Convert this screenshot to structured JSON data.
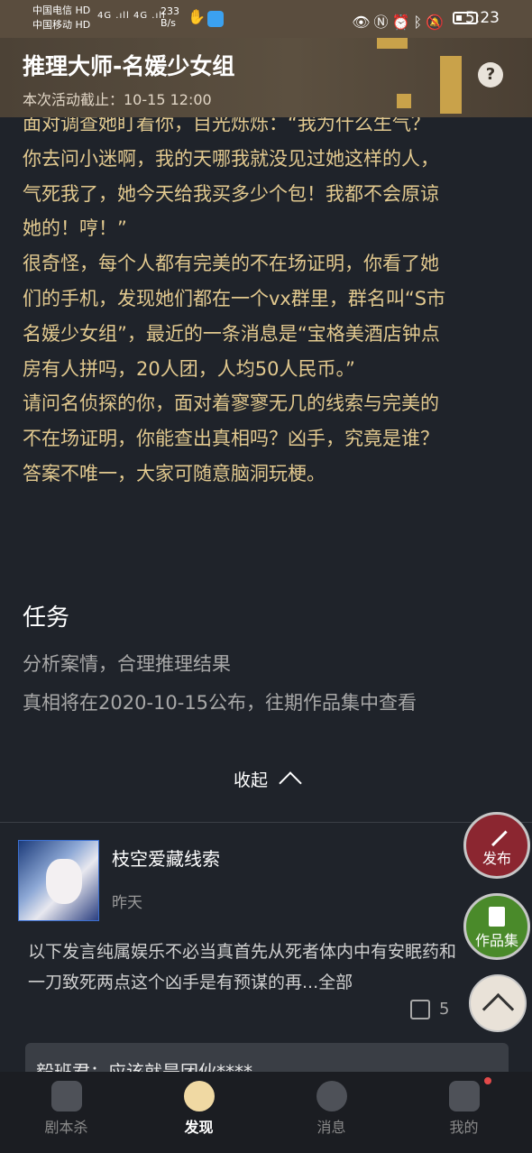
{
  "status_bar": {
    "carrier_1": "中国电信 HD",
    "carrier_2": "中国移动 HD",
    "signal": "4G .ıll 4G .ıll",
    "net_speed_value": "233",
    "net_speed_unit": "B/s",
    "icons": [
      "eye-icon",
      "nfc-icon",
      "alarm-icon",
      "bluetooth-icon",
      "mute-icon",
      "battery-icon"
    ],
    "time": "5:23"
  },
  "header": {
    "title": "推理大师-名媛少女组",
    "deadline": "本次活动截止：10-15 12:00",
    "help_glyph": "?"
  },
  "story": {
    "lines": [
      "面对调查她盯着你，目光烁烁：“我为什么生气？",
      "你去问小迷啊，我的天哪我就没见过她这样的人，",
      "气死我了，她今天给我买多少个包！我都不会原谅",
      "她的！哼！”",
      "很奇怪，每个人都有完美的不在场证明，你看了她",
      "们的手机，发现她们都在一个vx群里，群名叫“S市",
      "名媛少女组”，最近的一条消息是“宝格美酒店钟点",
      "房有人拼吗，20人团，人均50人民币。”",
      "请问名侦探的你，面对着寥寥无几的线索与完美的",
      "不在场证明，你能查出真相吗？凶手，究竟是谁？",
      "答案不唯一，大家可随意脑洞玩梗。"
    ]
  },
  "task": {
    "title": "任务",
    "line1": "分析案情，合理推理结果",
    "line2": "真相将在2020-10-15公布，往期作品集中查看"
  },
  "collapse_label": "收起",
  "post": {
    "username": "枝空爱藏线索",
    "time": "昨天",
    "text": "以下发言纯属娱乐不必当真首先从死者体内中有安眠药和一刀致死两点这个凶手是有预谋的再...",
    "more": "全部",
    "likes": "5",
    "comment_preview": "毅班君：应该就是团伙****"
  },
  "fab": {
    "publish": "发布",
    "works": "作品集"
  },
  "tabs": [
    {
      "label": "剧本杀",
      "icon": "script-book-icon"
    },
    {
      "label": "发现",
      "icon": "planet-icon"
    },
    {
      "label": "消息",
      "icon": "chat-bubble-icon"
    },
    {
      "label": "我的",
      "icon": "cat-face-icon"
    }
  ],
  "colors": {
    "accent_gold": "#e2c98f",
    "publish_red": "#8b2630",
    "works_green": "#4a8a2a",
    "badge_red": "#e34a4a"
  }
}
